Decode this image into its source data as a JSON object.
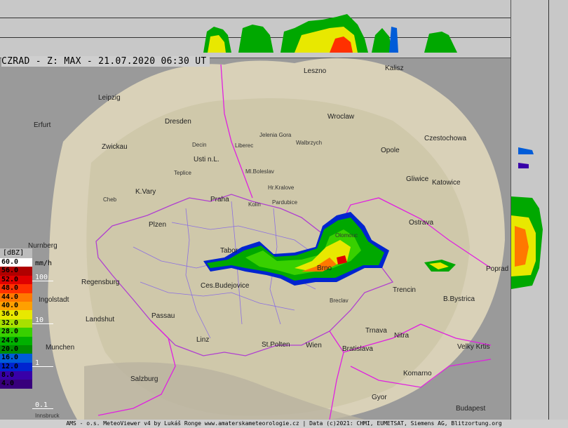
{
  "title": "CZRAD - Z: MAX - 21.07.2020 06:30 UT",
  "cities": [
    {
      "name": "Leszno",
      "small": false
    },
    {
      "name": "Kalisz",
      "small": false
    },
    {
      "name": "Leipzig",
      "small": false
    },
    {
      "name": "Dresden",
      "small": false
    },
    {
      "name": "Wroclaw",
      "small": false
    },
    {
      "name": "Erfurt",
      "small": false
    },
    {
      "name": "Jelenia Gora",
      "small": true
    },
    {
      "name": "Walbrzych",
      "small": true
    },
    {
      "name": "Czestochowa",
      "small": false
    },
    {
      "name": "Zwickau",
      "small": false
    },
    {
      "name": "Decin",
      "small": true
    },
    {
      "name": "Liberec",
      "small": true
    },
    {
      "name": "Opole",
      "small": false
    },
    {
      "name": "Usti n.L.",
      "small": false
    },
    {
      "name": "Ml.Boleslav",
      "small": true
    },
    {
      "name": "Teplice",
      "small": true
    },
    {
      "name": "Gliwice",
      "small": false
    },
    {
      "name": "Katowice",
      "small": false
    },
    {
      "name": "Hr.Kralove",
      "small": true
    },
    {
      "name": "K.Vary",
      "small": false
    },
    {
      "name": "Praha",
      "small": false
    },
    {
      "name": "Pardubice",
      "small": true
    },
    {
      "name": "Cheb",
      "small": true
    },
    {
      "name": "Kolin",
      "small": true
    },
    {
      "name": "Ostrava",
      "small": false
    },
    {
      "name": "Plzen",
      "small": false
    },
    {
      "name": "Olomouc",
      "small": true
    },
    {
      "name": "Nurnberg",
      "small": false
    },
    {
      "name": "Tabor",
      "small": false
    },
    {
      "name": "Brno",
      "small": false
    },
    {
      "name": "Poprad",
      "small": false
    },
    {
      "name": "Regensburg",
      "small": false
    },
    {
      "name": "Ces.Budejovice",
      "small": false
    },
    {
      "name": "Trencin",
      "small": false
    },
    {
      "name": "Ingolstadt",
      "small": false
    },
    {
      "name": "B.Bystrica",
      "small": false
    },
    {
      "name": "Breclav",
      "small": true
    },
    {
      "name": "Passau",
      "small": false
    },
    {
      "name": "Landshut",
      "small": false
    },
    {
      "name": "Trnava",
      "small": false
    },
    {
      "name": "Nitra",
      "small": false
    },
    {
      "name": "Linz",
      "small": false
    },
    {
      "name": "St.Polten",
      "small": false
    },
    {
      "name": "Wien",
      "small": false
    },
    {
      "name": "Munchen",
      "small": false
    },
    {
      "name": "Bratislava",
      "small": false
    },
    {
      "name": "Velky Krtis",
      "small": false
    },
    {
      "name": "Salzburg",
      "small": false
    },
    {
      "name": "Komarno",
      "small": false
    },
    {
      "name": "Gyor",
      "small": false
    },
    {
      "name": "Budapest",
      "small": false
    },
    {
      "name": "Innsbruck",
      "small": true
    }
  ],
  "legend": {
    "unit_dbz": "[dBZ]",
    "unit_rain": "mm/h",
    "rows": [
      {
        "label": "60.0",
        "color": "#ffffff",
        "text": "#000000"
      },
      {
        "label": "56.0",
        "color": "#b00000",
        "text": "#000000"
      },
      {
        "label": "52.0",
        "color": "#e00000",
        "text": "#000000"
      },
      {
        "label": "48.0",
        "color": "#ff3000",
        "text": "#000000"
      },
      {
        "label": "44.0",
        "color": "#ff7800",
        "text": "#000000"
      },
      {
        "label": "40.0",
        "color": "#ffa000",
        "text": "#000000"
      },
      {
        "label": "36.0",
        "color": "#e8e800",
        "text": "#000000"
      },
      {
        "label": "32.0",
        "color": "#a8e000",
        "text": "#000000"
      },
      {
        "label": "28.0",
        "color": "#38d000",
        "text": "#000000"
      },
      {
        "label": "24.0",
        "color": "#00b000",
        "text": "#000000"
      },
      {
        "label": "20.0",
        "color": "#008c00",
        "text": "#000000"
      },
      {
        "label": "16.0",
        "color": "#005cd8",
        "text": "#000000"
      },
      {
        "label": "12.0",
        "color": "#0024d0",
        "text": "#000000"
      },
      {
        "label": "8.0",
        "color": "#3800a8",
        "text": "#000000"
      },
      {
        "label": "4.0",
        "color": "#38007c",
        "text": "#000000"
      }
    ],
    "rain_rates": [
      "100",
      "10",
      "1",
      "0.1"
    ]
  },
  "footer": "AMS - o.s. MeteoViewer v4 by Lukáš Ronge www.amaterskameteorologie.cz | Data (c)2021: CHMI, EUMETSAT, Siemens AG, Blitzortung.org"
}
